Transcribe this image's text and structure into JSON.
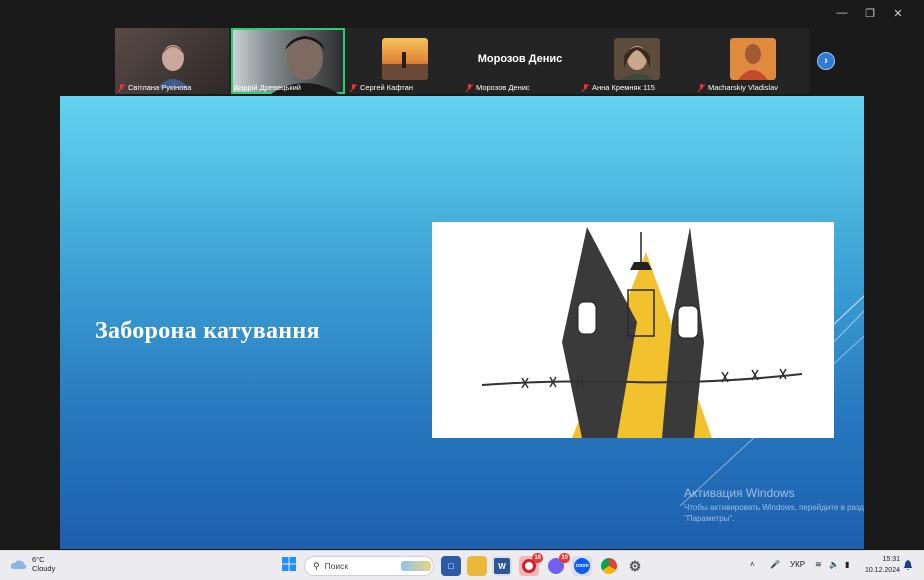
{
  "participants": [
    {
      "name": "Світлана Рукінова",
      "active": false
    },
    {
      "name": "Андрій Древецький",
      "active": true
    },
    {
      "name": "Сергей Кафтан",
      "active": false
    },
    {
      "name": "Морозов Денис",
      "display_name": "Морозов Денис",
      "active": false
    },
    {
      "name": "Анна Кремняк 115",
      "active": false
    },
    {
      "name": "Macharskiy Vladislav",
      "active": false
    }
  ],
  "slide": {
    "title": "Заборона катування"
  },
  "watermark": {
    "line1": "Активация Windows",
    "line2": "Чтобы активировать Windows, перейдите в раздел \"Параметры\"."
  },
  "taskbar": {
    "weather_temp": "6°C",
    "weather_cond": "Cloudy",
    "search_placeholder": "Поиск",
    "language": "УКР",
    "time": "15:31",
    "date": "10.12.2024",
    "badges": {
      "opera": "16",
      "viber": "10"
    }
  },
  "colors": {
    "active_speaker": "#2ecc71",
    "slide_top": "#63d3f0",
    "slide_bottom": "#1d5fad",
    "accent_yellow": "#f2c12e"
  }
}
